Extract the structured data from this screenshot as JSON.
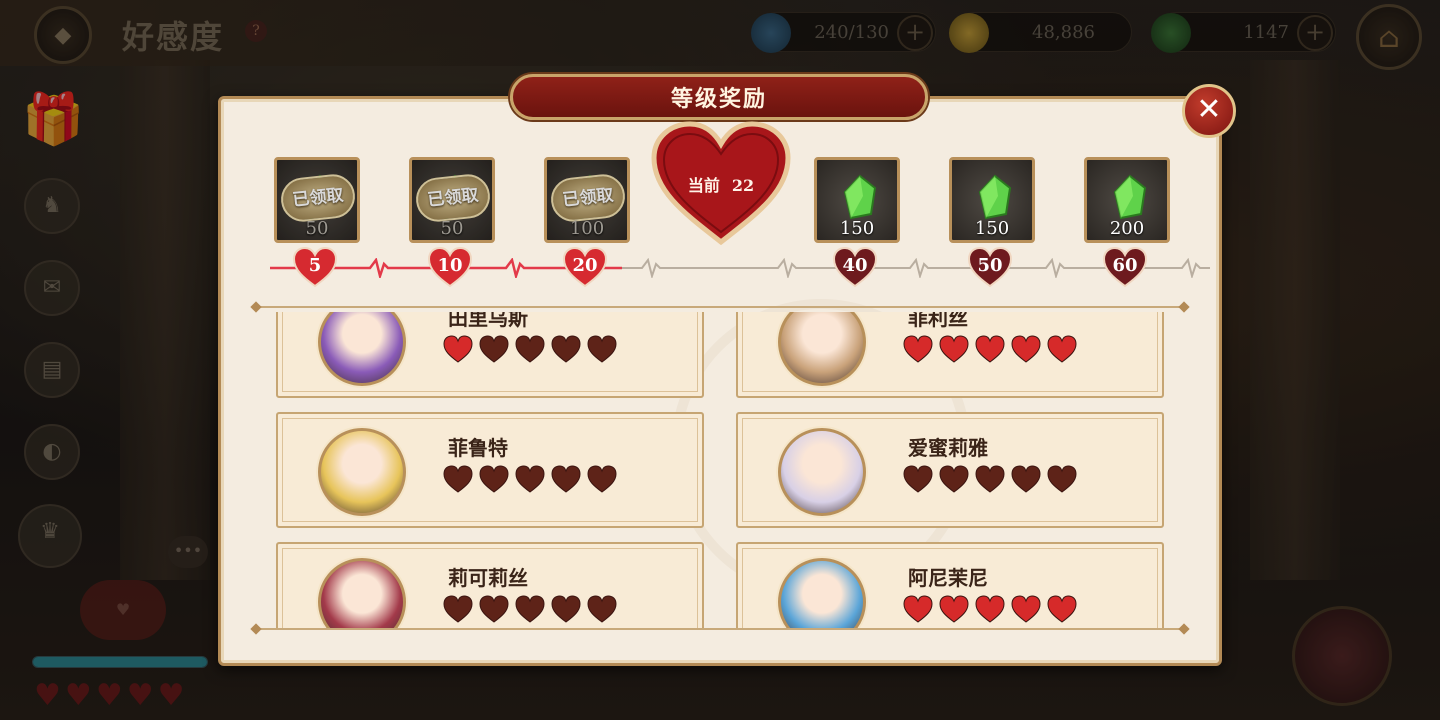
{
  "header": {
    "title": "好感度",
    "help": "?",
    "stamina": "240/130",
    "gold": "48,886",
    "gems": "1147"
  },
  "modal": {
    "title": "等级奖励",
    "current_label": "当前",
    "current_level": "22"
  },
  "rewards": [
    {
      "amount": "50",
      "claimed": true,
      "stamp": "已领取"
    },
    {
      "amount": "50",
      "claimed": true,
      "stamp": "已领取"
    },
    {
      "amount": "100",
      "claimed": true,
      "stamp": "已领取"
    },
    {
      "amount": "150",
      "claimed": false
    },
    {
      "amount": "150",
      "claimed": false
    },
    {
      "amount": "200",
      "claimed": false
    }
  ],
  "levels": [
    "5",
    "10",
    "20",
    "40",
    "50",
    "60"
  ],
  "characters": [
    {
      "name": "田里乌斯",
      "hearts": 5,
      "filled": 1,
      "color": "#8a5bb8"
    },
    {
      "name": "菲利丝",
      "hearts": 5,
      "filled": 5,
      "color": "#c9a27a"
    },
    {
      "name": "菲鲁特",
      "hearts": 5,
      "filled": 0,
      "color": "#e7c45a"
    },
    {
      "name": "爱蜜莉雅",
      "hearts": 5,
      "filled": 0,
      "color": "#d8d0e6"
    },
    {
      "name": "莉可莉丝",
      "hearts": 5,
      "filled": 0,
      "color": "#a33a4a"
    },
    {
      "name": "阿尼茉尼",
      "hearts": 5,
      "filled": 5,
      "color": "#5aa5d8"
    }
  ],
  "colors": {
    "accent": "#8f2118",
    "heart_filled": "#d62a2a",
    "heart_empty": "#5e2318",
    "gem": "#5fd24a"
  }
}
